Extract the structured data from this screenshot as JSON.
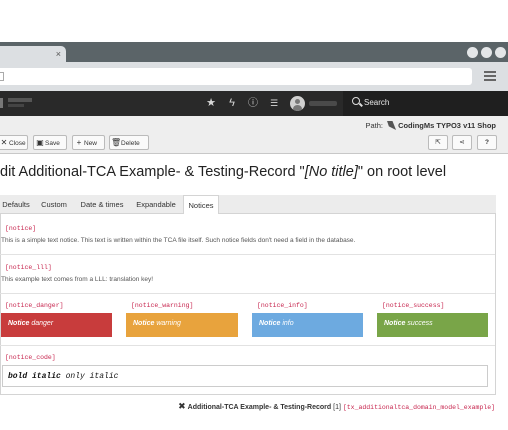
{
  "browser": {
    "tab_close": "×"
  },
  "toolbar": {
    "search_label": "Search"
  },
  "docheader": {
    "path_label": "Path:",
    "path_value": "CodingMs TYPO3 v11 Shop",
    "buttons": {
      "close": "Close",
      "save": "Save",
      "new": "New",
      "delete": "Delete",
      "help": "?"
    }
  },
  "heading": {
    "prefix": "dit Additional-TCA Example- & Testing-Record \"",
    "no_title": "[No title]",
    "suffix": "\" on root level"
  },
  "tabs": [
    {
      "label": "Defaults",
      "active": false
    },
    {
      "label": "Custom",
      "active": false
    },
    {
      "label": "Date & times",
      "active": false
    },
    {
      "label": "Expandable",
      "active": false
    },
    {
      "label": "Notices",
      "active": true
    }
  ],
  "notices": {
    "notice": {
      "key": "[notice]",
      "text": "This is a simple text notice. This text is written within the TCA file itself. Such notice fields don't need a field in the database."
    },
    "notice_lll": {
      "key": "[notice_lll]",
      "text": "This example text comes from a LLL: translation key!"
    },
    "callouts": [
      {
        "key": "[notice_danger]",
        "strong": "Notice",
        "em": "danger",
        "color": "#c83c3c"
      },
      {
        "key": "[notice_warning]",
        "strong": "Notice",
        "em": "warning",
        "color": "#e8a33d"
      },
      {
        "key": "[notice_info]",
        "strong": "Notice",
        "em": "info",
        "color": "#6daae0"
      },
      {
        "key": "[notice_success]",
        "strong": "Notice",
        "em": "success",
        "color": "#79a548"
      }
    ],
    "notice_code": {
      "key": "[notice_code]",
      "bold_italic": "bold italic",
      "italic": "only italic"
    }
  },
  "footer": {
    "record_title": "Additional-TCA Example- & Testing-Record",
    "uid": "[1]",
    "table": "[tx_additionaltca_domain_model_example]"
  }
}
